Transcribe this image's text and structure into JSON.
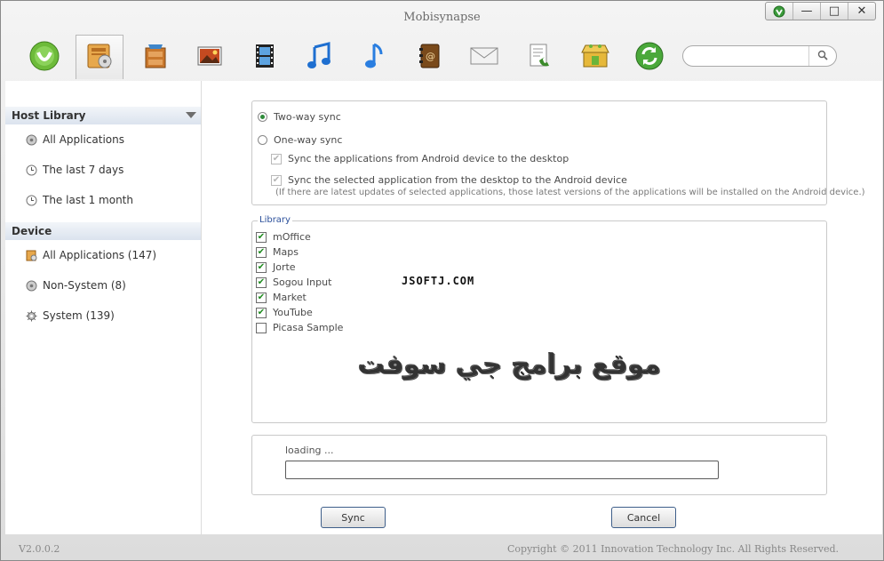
{
  "window": {
    "title": "Mobisynapse",
    "controls": {
      "min": "—",
      "max": "□",
      "close": "✕"
    }
  },
  "toolbar": {
    "tools": [
      {
        "name": "android-device",
        "icon": "android-icon"
      },
      {
        "name": "applications",
        "icon": "app-box-icon",
        "active": true
      },
      {
        "name": "files",
        "icon": "file-cabinet-icon"
      },
      {
        "name": "photos",
        "icon": "photo-icon"
      },
      {
        "name": "videos",
        "icon": "film-icon"
      },
      {
        "name": "music",
        "icon": "music-note-icon"
      },
      {
        "name": "ringtones",
        "icon": "note-icon"
      },
      {
        "name": "contacts",
        "icon": "contacts-book-icon"
      },
      {
        "name": "messages",
        "icon": "envelope-icon"
      },
      {
        "name": "call-log",
        "icon": "call-log-icon"
      },
      {
        "name": "app-store",
        "icon": "store-icon"
      },
      {
        "name": "sync",
        "icon": "sync-icon"
      }
    ],
    "search_placeholder": ""
  },
  "sidebar": {
    "host_library": {
      "title": "Host Library",
      "items": [
        {
          "label": "All Applications",
          "icon": "disc-icon"
        },
        {
          "label": "The last 7 days",
          "icon": "clock-icon"
        },
        {
          "label": "The last 1 month",
          "icon": "clock-icon"
        }
      ]
    },
    "device": {
      "title": "Device",
      "items": [
        {
          "label": "All Applications (147)",
          "icon": "app-box-icon"
        },
        {
          "label": "Non-System (8)",
          "icon": "disc-icon"
        },
        {
          "label": "System (139)",
          "icon": "gear-icon"
        }
      ]
    }
  },
  "sync_options": {
    "two_way": {
      "label": "Two-way sync",
      "selected": true
    },
    "one_way": {
      "label": "One-way sync",
      "selected": false
    },
    "option1": {
      "label": "Sync the applications from Android device to the desktop",
      "checked": true
    },
    "option2": {
      "label": "Sync the selected application from the desktop to the Android device",
      "checked": true
    },
    "note": "(If there are latest updates of selected applications, those latest versions of the applications will be installed on the Android device.)"
  },
  "library": {
    "legend": "Library",
    "items": [
      {
        "label": "mOffice",
        "checked": true
      },
      {
        "label": "Maps",
        "checked": true
      },
      {
        "label": "Jorte",
        "checked": true
      },
      {
        "label": "Sogou Input",
        "checked": true
      },
      {
        "label": "Market",
        "checked": true
      },
      {
        "label": "YouTube",
        "checked": true
      },
      {
        "label": "Picasa Sample",
        "checked": false
      }
    ]
  },
  "watermark": {
    "latin": "JSOFTJ.COM",
    "arabic": "موقع برامج جي سوفت"
  },
  "progress": {
    "label": "loading ...",
    "value": 0
  },
  "buttons": {
    "sync": "Sync",
    "cancel": "Cancel"
  },
  "status": {
    "version": "V2.0.0.2",
    "copyright": "Copyright © 2011 Innovation Technology Inc. All Rights Reserved."
  },
  "colors": {
    "accent_green": "#2e8b3a",
    "check_green": "#1d8a1d",
    "legend_blue": "#2a4f9a"
  }
}
